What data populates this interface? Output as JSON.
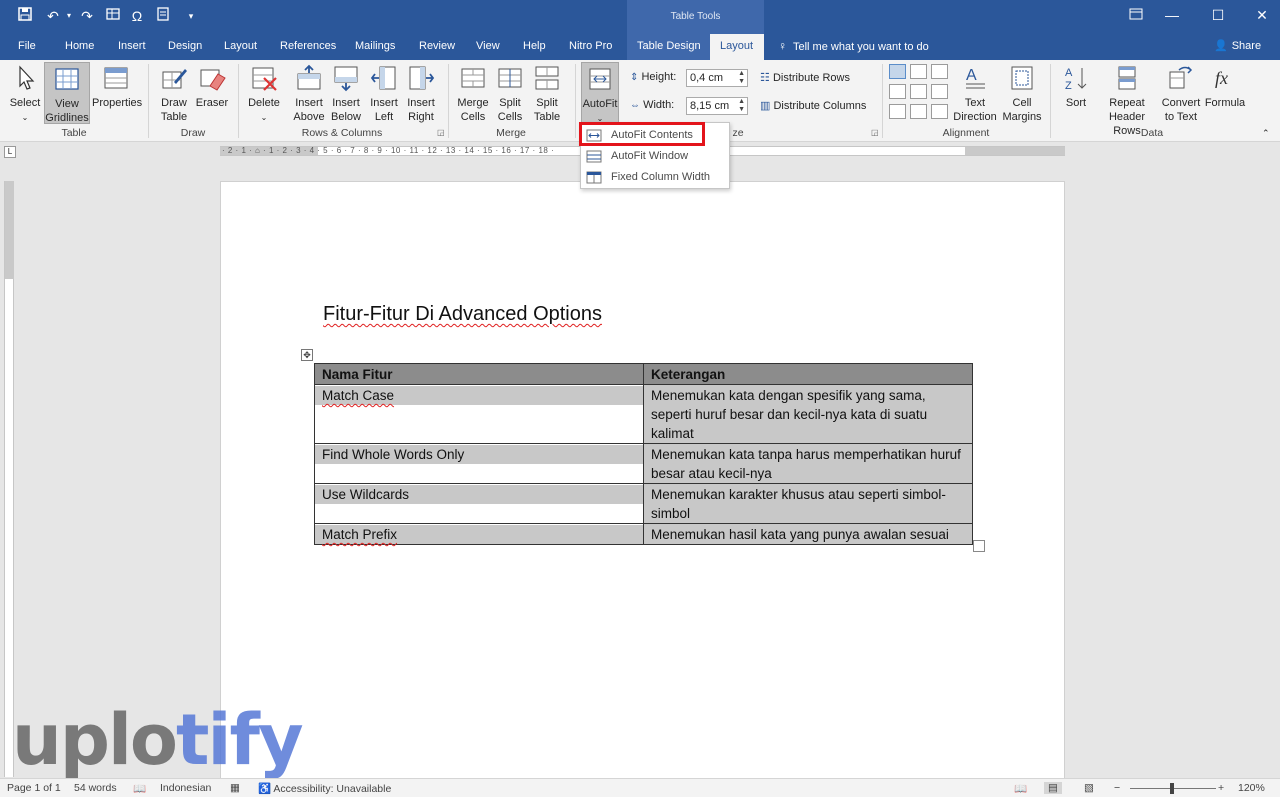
{
  "titlebar": {
    "context_group": "Table Tools"
  },
  "tabs": [
    {
      "label": "File"
    },
    {
      "label": "Home"
    },
    {
      "label": "Insert"
    },
    {
      "label": "Design"
    },
    {
      "label": "Layout"
    },
    {
      "label": "References"
    },
    {
      "label": "Mailings"
    },
    {
      "label": "Review"
    },
    {
      "label": "View"
    },
    {
      "label": "Help"
    },
    {
      "label": "Nitro Pro"
    },
    {
      "label": "Table Design"
    },
    {
      "label": "Layout"
    }
  ],
  "tell_me": "Tell me what you want to do",
  "share": "Share",
  "ribbon": {
    "select": "Select",
    "view_gridlines": [
      "View",
      "Gridlines"
    ],
    "properties": "Properties",
    "group_table": "Table",
    "draw_table": [
      "Draw",
      "Table"
    ],
    "eraser": "Eraser",
    "group_draw": "Draw",
    "delete": "Delete",
    "insert_above": [
      "Insert",
      "Above"
    ],
    "insert_below": [
      "Insert",
      "Below"
    ],
    "insert_left": [
      "Insert",
      "Left"
    ],
    "insert_right": [
      "Insert",
      "Right"
    ],
    "group_rows_cols": "Rows & Columns",
    "merge_cells": [
      "Merge",
      "Cells"
    ],
    "split_cells": [
      "Split",
      "Cells"
    ],
    "split_table": [
      "Split",
      "Table"
    ],
    "group_merge": "Merge",
    "autofit": "AutoFit",
    "height_label": "Height:",
    "height_value": "0,4 cm",
    "width_label": "Width:",
    "width_value": "8,15 cm",
    "distribute_rows": "Distribute Rows",
    "distribute_columns": "Distribute Columns",
    "group_cell_size_partial": "ze",
    "text_direction": [
      "Text",
      "Direction"
    ],
    "cell_margins": [
      "Cell",
      "Margins"
    ],
    "group_alignment": "Alignment",
    "sort": "Sort",
    "repeat_header_rows": [
      "Repeat",
      "Header Rows"
    ],
    "convert_to_text": [
      "Convert",
      "to Text"
    ],
    "formula": "Formula",
    "group_data": "Data"
  },
  "autofit_menu": [
    {
      "label": "AutoFit Contents"
    },
    {
      "label": "AutoFit Window"
    },
    {
      "label": "Fixed Column Width"
    }
  ],
  "ruler": {
    "text": "· 2 · 1 · ⌂ · 1 · 2 · 3 · 4 · 5 · 6 · 7 · 8 · 9 · 10 · 11 · 12 · 13 · 14 · 15 · 16 · 17 · 18 ·"
  },
  "document": {
    "heading": "Fitur-Fitur Di Advanced Options",
    "table": {
      "headers": [
        "Nama Fitur",
        "Keterangan"
      ],
      "rows": [
        [
          "Match Case",
          "Menemukan kata dengan spesifik yang sama, seperti huruf besar dan kecil-nya kata di suatu kalimat"
        ],
        [
          "Find Whole Words Only",
          "Menemukan kata tanpa harus memperhatikan huruf besar atau kecil-nya"
        ],
        [
          "Use Wildcards",
          "Menemukan karakter khusus atau seperti simbol-simbol"
        ],
        [
          "Match Prefix",
          "Menemukan hasil kata yang punya awalan sesuai"
        ]
      ]
    }
  },
  "watermark": {
    "part1": "uplo",
    "part2": "tify"
  },
  "statusbar": {
    "page": "Page 1 of 1",
    "words": "54 words",
    "language": "Indonesian",
    "accessibility": "Accessibility: Unavailable",
    "zoom": "120%"
  },
  "colors": {
    "title_bar": "#2b579a",
    "context_tab": "#3f68ab",
    "highlight_box": "#e3141b"
  }
}
